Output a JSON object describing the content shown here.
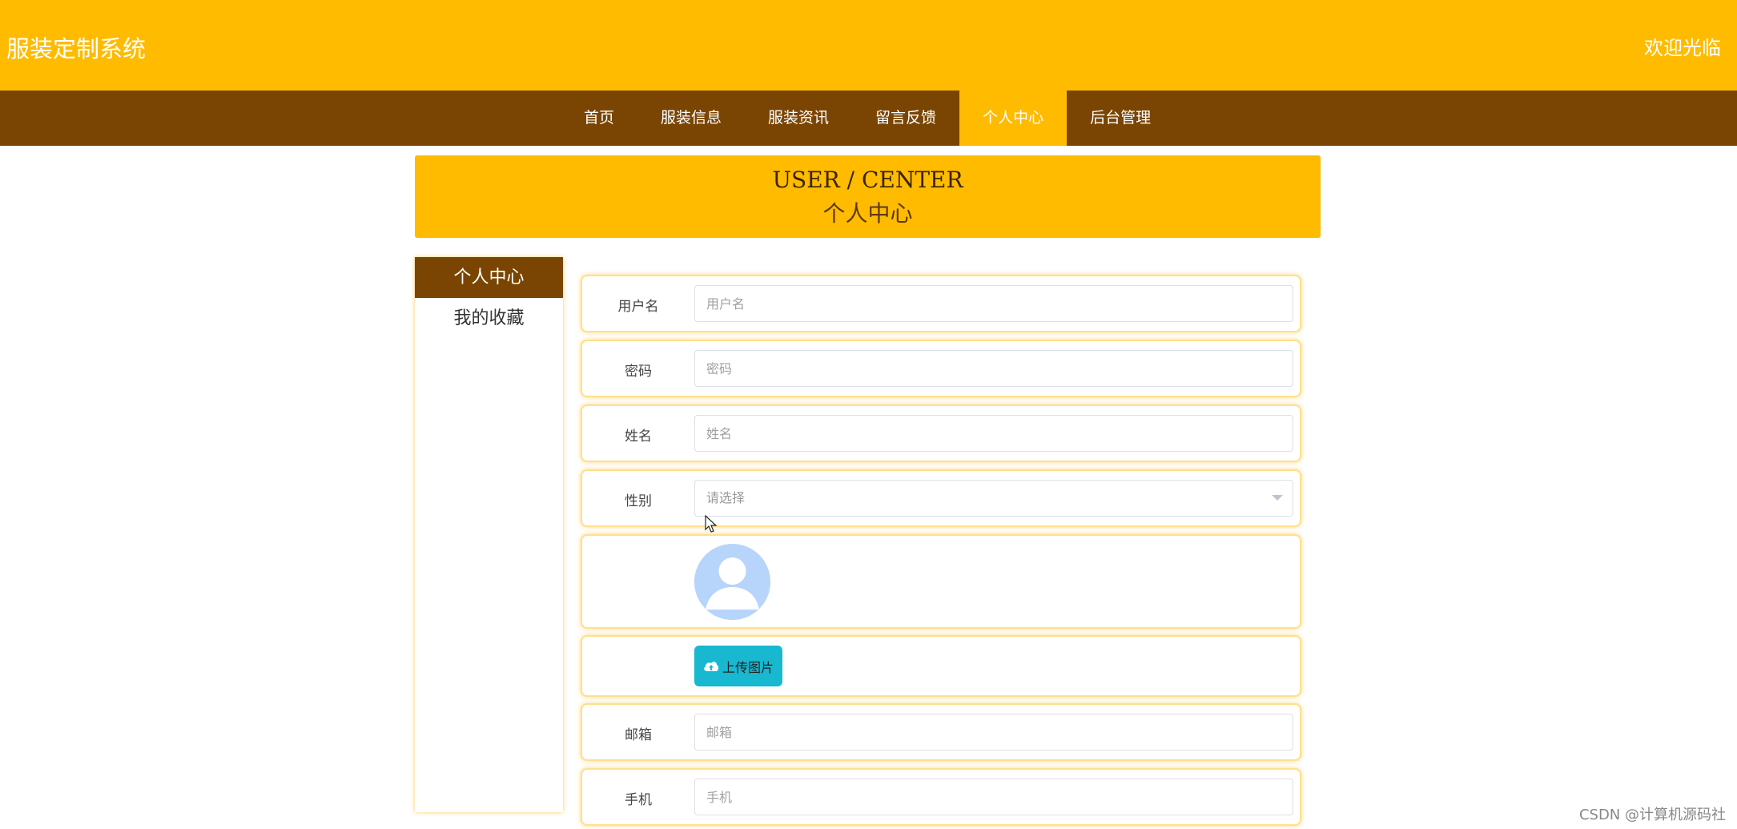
{
  "header": {
    "title": "服装定制系统",
    "welcome": "欢迎光临"
  },
  "nav": {
    "items": [
      {
        "label": "首页"
      },
      {
        "label": "服装信息"
      },
      {
        "label": "服装资讯"
      },
      {
        "label": "留言反馈"
      },
      {
        "label": "个人中心"
      },
      {
        "label": "后台管理"
      }
    ],
    "active_index": 4
  },
  "banner": {
    "title_en": "USER / CENTER",
    "title_cn": "个人中心"
  },
  "sidebar": {
    "items": [
      {
        "label": "个人中心"
      },
      {
        "label": "我的收藏"
      }
    ],
    "active_index": 0
  },
  "form": {
    "username": {
      "label": "用户名",
      "placeholder": "用户名",
      "value": ""
    },
    "password": {
      "label": "密码",
      "placeholder": "密码",
      "value": ""
    },
    "name": {
      "label": "姓名",
      "placeholder": "姓名",
      "value": ""
    },
    "gender": {
      "label": "性别",
      "placeholder": "请选择"
    },
    "upload_label": "上传图片",
    "email": {
      "label": "邮箱",
      "placeholder": "邮箱",
      "value": ""
    },
    "phone": {
      "label": "手机",
      "placeholder": "手机",
      "value": ""
    }
  },
  "watermark": "CSDN @计算机源码社",
  "colors": {
    "primary": "#ffbb00",
    "nav": "#7a4503",
    "upload": "#17b8d0",
    "avatar": "#b7d4fb"
  }
}
